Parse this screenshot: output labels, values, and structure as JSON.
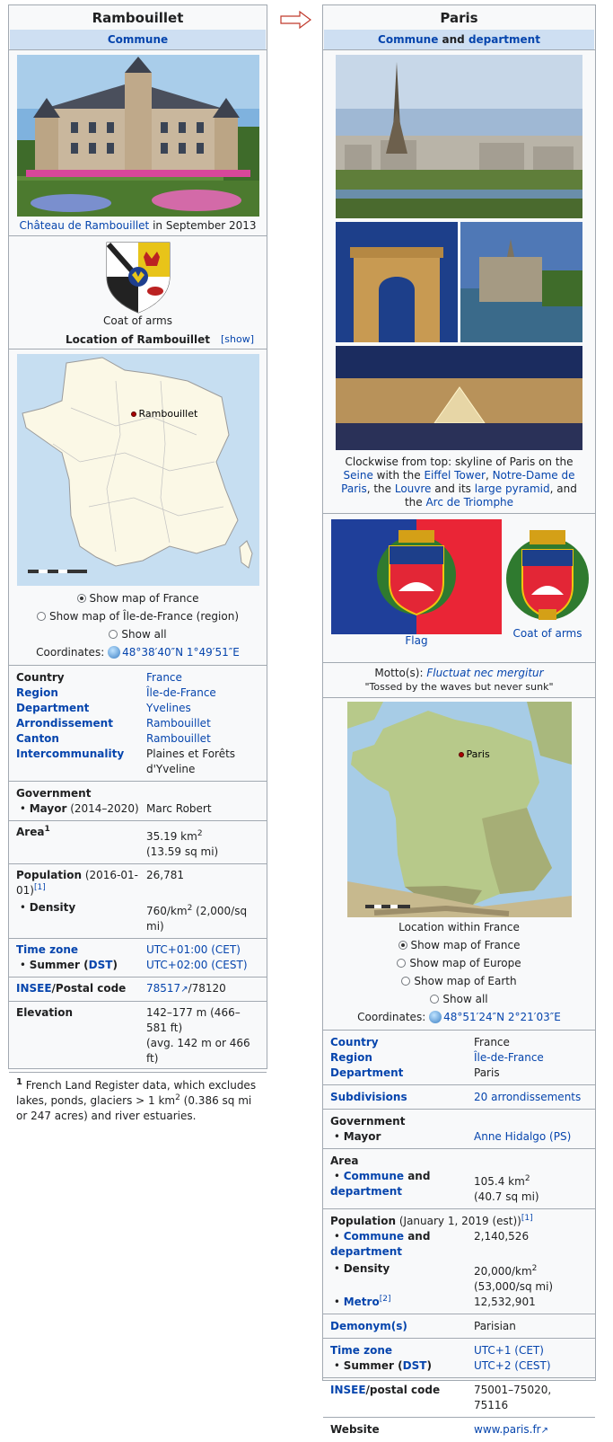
{
  "arrow_icon": "right-arrow-outline",
  "left": {
    "title": "Rambouillet",
    "subtitle": "Commune",
    "photo_caption_link": "Château de Rambouillet",
    "photo_caption_rest": " in September 2013",
    "coat_label": "Coat of arms",
    "location_label": "Location of Rambouillet",
    "show_label": "[show]",
    "map_pin_label": "Rambouillet",
    "map_options": [
      "Show map of France",
      "Show map of Île-de-France (region)",
      "Show all"
    ],
    "coords_label": "Coordinates:",
    "coords_value": "48°38′40″N 1°49′51″E",
    "facts": [
      {
        "k": "Country",
        "v": "France"
      },
      {
        "k": "Region",
        "v": "Île-de-France"
      },
      {
        "k": "Department",
        "v": "Yvelines"
      },
      {
        "k": "Arrondissement",
        "v": "Rambouillet"
      },
      {
        "k": "Canton",
        "v": "Rambouillet"
      },
      {
        "k": "Intercommunality",
        "v": "Plaines et Forêts d'Yveline"
      }
    ],
    "government_label": "Government",
    "mayor_label": "Mayor",
    "mayor_term": " (2014–2020)",
    "mayor_value": "Marc Robert",
    "area_label": "Area",
    "area_sup": "1",
    "area_value_1": "35.19 km",
    "area_value_2": "(13.59 sq mi)",
    "population_label": "Population",
    "population_date": " (2016-01-01)",
    "population_ref": "[1]",
    "population_value": "26,781",
    "density_label": "Density",
    "density_value_a": "760/km",
    "density_value_b": " (2,000/sq mi)",
    "timezone_label": "Time zone",
    "timezone_value": "UTC+01:00 (CET)",
    "summer_label": "Summer (",
    "dst_label": "DST",
    "summer_close": ")",
    "summer_value": "UTC+02:00 (CEST)",
    "insee_label": "INSEE",
    "postal_label": "/Postal code",
    "insee_value": "78517",
    "postal_value": "/78120",
    "elevation_label": "Elevation",
    "elevation_value_1": "142–177 m (466–581 ft)",
    "elevation_value_2": "(avg. 142 m or 466 ft)",
    "footnote_sup": "1",
    "footnote_text_a": " French Land Register data, which excludes lakes, ponds, glaciers > 1 km",
    "footnote_text_b": " (0.386 sq mi or 247 acres) and river estuaries."
  },
  "right": {
    "title": "Paris",
    "subtitle_a": "Commune",
    "subtitle_and": " and ",
    "subtitle_b": "department",
    "caption": {
      "p1": "Clockwise from top: skyline of Paris on the ",
      "l1": "Seine",
      "p2": " with the ",
      "l2": "Eiffel Tower",
      "p3": ", ",
      "l3": "Notre-Dame de Paris",
      "p4": ", the ",
      "l4": "Louvre",
      "p5": " and its ",
      "l5": "large pyramid",
      "p6": ", and the ",
      "l6": "Arc de Triomphe"
    },
    "flag_label": "Flag",
    "coat_label": "Coat of arms",
    "motto_label": "Motto(s): ",
    "motto_value": "Fluctuat nec mergitur",
    "motto_translation": "\"Tossed by the waves but never sunk\"",
    "map_pin_label": "Paris",
    "map_caption": "Location within France",
    "map_options": [
      "Show map of France",
      "Show map of Europe",
      "Show map of Earth",
      "Show all"
    ],
    "coords_label": "Coordinates:",
    "coords_value": "48°51′24″N 2°21′03″E",
    "facts": [
      {
        "k": "Country",
        "v": "France"
      },
      {
        "k": "Region",
        "v": "Île-de-France"
      },
      {
        "k": "Department",
        "v": "Paris"
      }
    ],
    "subdivisions_label": "Subdivisions",
    "subdivisions_value": "20 arrondissements",
    "government_label": "Government",
    "mayor_label": "Mayor",
    "mayor_value": "Anne Hidalgo (PS)",
    "area_label": "Area",
    "area_sub_a": "Commune",
    "area_sub_and": " and",
    "area_sub_b": "department",
    "area_value_1": "105.4 km",
    "area_value_2": "(40.7 sq mi)",
    "population_label": "Population",
    "population_date": " (January 1, 2019 (est))",
    "population_ref": "[1]",
    "pop_commune_a": "Commune",
    "pop_commune_and": " and",
    "pop_commune_b": "department",
    "pop_commune_value": "2,140,526",
    "density_label": "Density",
    "density_value_1": "20,000/km",
    "density_value_2": "(53,000/sq mi)",
    "metro_label": "Metro",
    "metro_ref": "[2]",
    "metro_value": "12,532,901",
    "demonym_label": "Demonym(s)",
    "demonym_value": "Parisian",
    "timezone_label": "Time zone",
    "timezone_value": "UTC+1 (CET)",
    "summer_label": "Summer (",
    "dst_label": "DST",
    "summer_close": ")",
    "summer_value": "UTC+2 (CEST)",
    "insee_label": "INSEE",
    "postal_label": "/postal code",
    "postal_value": "75001–75020, 75116",
    "website_label": "Website",
    "website_value": "www.paris.fr"
  }
}
